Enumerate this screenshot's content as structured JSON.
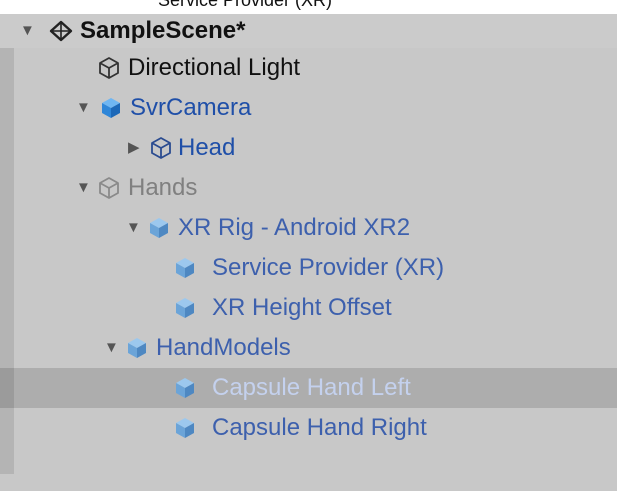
{
  "top_caption": "Service Provider (XR)",
  "scene": {
    "name": "SampleScene*"
  },
  "items": [
    {
      "label": "Directional Light"
    },
    {
      "label": "SvrCamera"
    },
    {
      "label": "Head"
    },
    {
      "label": "Hands"
    },
    {
      "label": "XR Rig - Android XR2"
    },
    {
      "label": "Service Provider (XR)"
    },
    {
      "label": "XR Height Offset"
    },
    {
      "label": "HandModels"
    },
    {
      "label": "Capsule Hand Left"
    },
    {
      "label": "Capsule Hand Right"
    }
  ],
  "colors": {
    "background": "#c8c8c8",
    "selected_row": "#adadad",
    "prefab_blue": "#1f4fa8",
    "prefab_cube": "#3d8fe0",
    "inactive_text": "#808080"
  }
}
